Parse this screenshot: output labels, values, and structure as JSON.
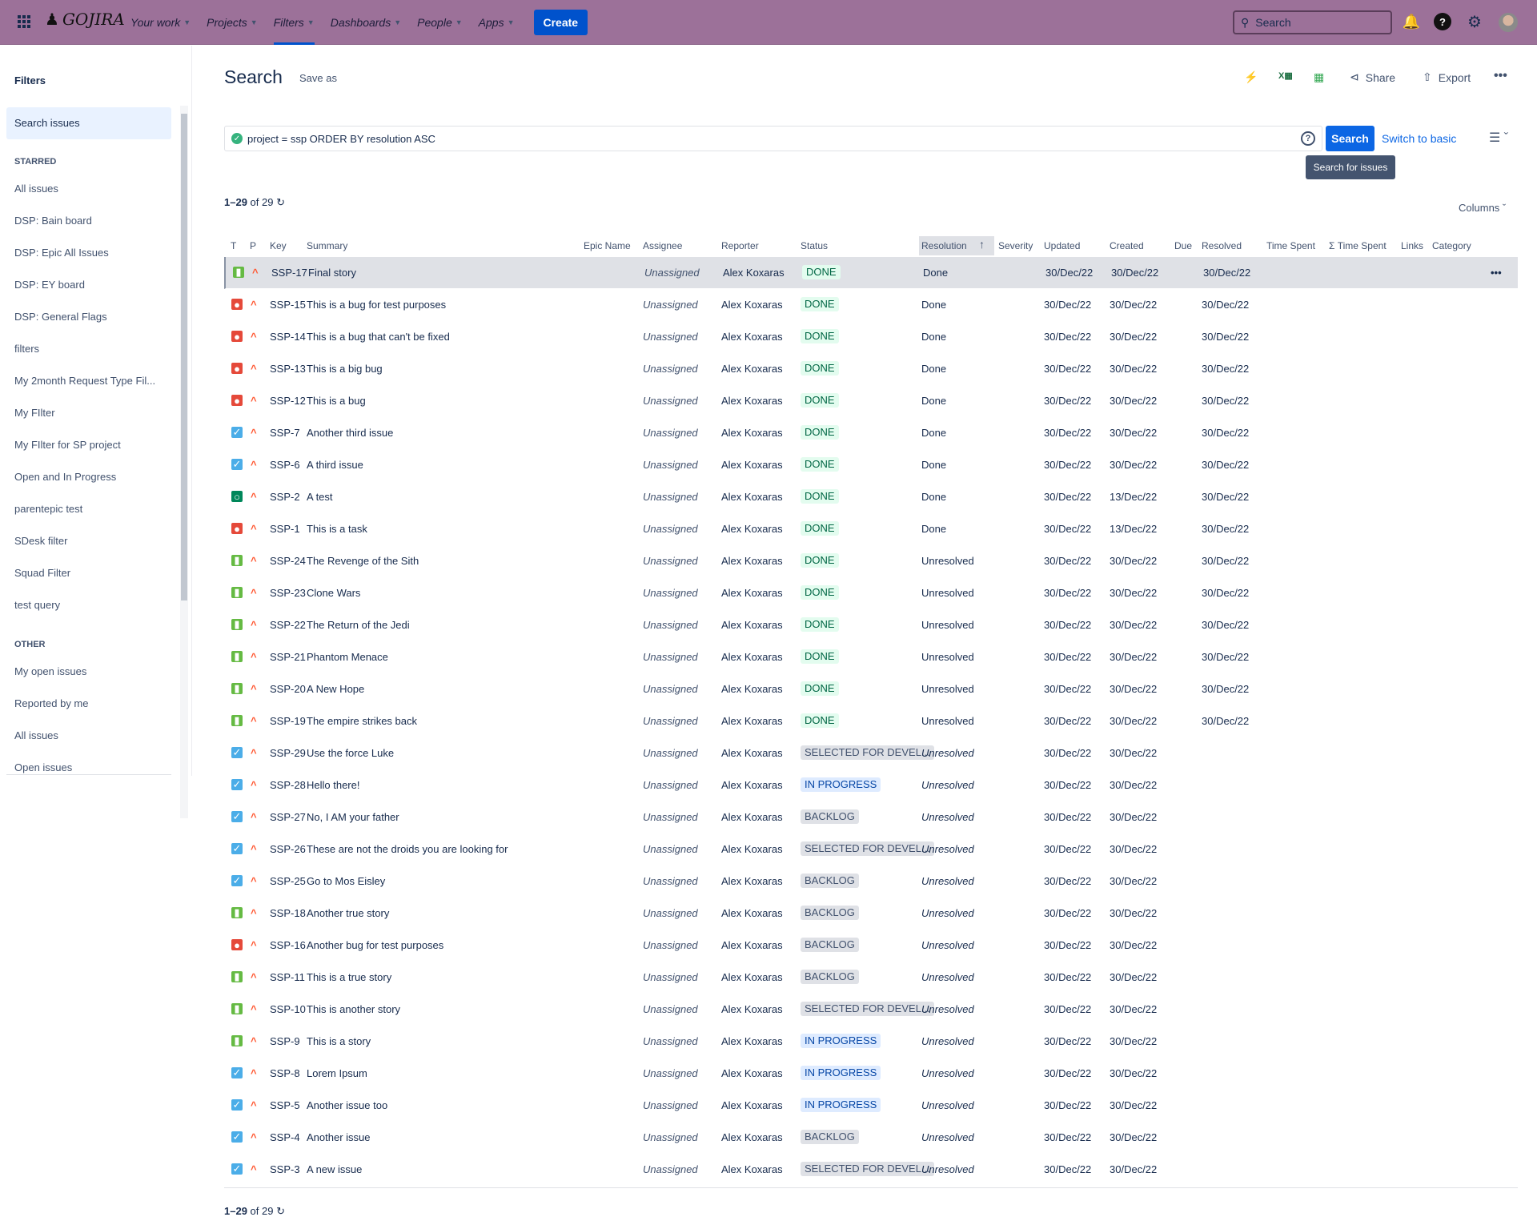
{
  "topnav": {
    "logo": "GOJIRA",
    "items": [
      "Your work",
      "Projects",
      "Filters",
      "Dashboards",
      "People",
      "Apps"
    ],
    "create": "Create",
    "search_placeholder": "Search"
  },
  "sidebar": {
    "title": "Filters",
    "selected": "Search issues",
    "starred_label": "STARRED",
    "starred": [
      "All issues",
      "DSP: Bain board",
      "DSP: Epic All Issues",
      "DSP: EY board",
      "DSP: General Flags",
      "filters",
      "My 2month Request Type Fil...",
      "My FIlter",
      "My FIlter for SP project",
      "Open and In Progress",
      "parentepic test",
      "SDesk filter",
      "Squad Filter",
      "test query"
    ],
    "other_label": "OTHER",
    "other": [
      "My open issues",
      "Reported by me",
      "All issues",
      "Open issues"
    ]
  },
  "page": {
    "title": "Search",
    "save_as": "Save as",
    "share": "Share",
    "export": "Export",
    "jql": "project = ssp ORDER BY resolution ASC",
    "search_button": "Search",
    "switch": "Switch to basic",
    "tooltip": "Search for issues",
    "count_range": "1–29",
    "count_of": "of 29",
    "columns": "Columns"
  },
  "columns": [
    "T",
    "P",
    "Key",
    "Summary",
    "Epic Name",
    "Assignee",
    "Reporter",
    "Status",
    "Resolution",
    "Severity",
    "Updated",
    "Created",
    "Due",
    "Resolved",
    "Time Spent",
    "Σ Time Spent",
    "Links",
    "Category"
  ],
  "colors": {
    "topbar": "#9c7199",
    "primary": "#0c66e4",
    "story": "#65ba43",
    "bug": "#e5493a",
    "task": "#4bade8",
    "other": "#00875a"
  },
  "issues": [
    [
      "story",
      "SSP-17",
      "Final story",
      "Unassigned",
      "Alex Koxaras",
      "DONE",
      "Done",
      "30/Dec/22",
      "30/Dec/22",
      "30/Dec/22"
    ],
    [
      "bug",
      "SSP-15",
      "This is a bug for test purposes",
      "Unassigned",
      "Alex Koxaras",
      "DONE",
      "Done",
      "30/Dec/22",
      "30/Dec/22",
      "30/Dec/22"
    ],
    [
      "bug",
      "SSP-14",
      "This is a bug that can't be fixed",
      "Unassigned",
      "Alex Koxaras",
      "DONE",
      "Done",
      "30/Dec/22",
      "30/Dec/22",
      "30/Dec/22"
    ],
    [
      "bug",
      "SSP-13",
      "This is a big bug",
      "Unassigned",
      "Alex Koxaras",
      "DONE",
      "Done",
      "30/Dec/22",
      "30/Dec/22",
      "30/Dec/22"
    ],
    [
      "bug",
      "SSP-12",
      "This is a bug",
      "Unassigned",
      "Alex Koxaras",
      "DONE",
      "Done",
      "30/Dec/22",
      "30/Dec/22",
      "30/Dec/22"
    ],
    [
      "task",
      "SSP-7",
      "Another third issue",
      "Unassigned",
      "Alex Koxaras",
      "DONE",
      "Done",
      "30/Dec/22",
      "30/Dec/22",
      "30/Dec/22"
    ],
    [
      "task",
      "SSP-6",
      "A third issue",
      "Unassigned",
      "Alex Koxaras",
      "DONE",
      "Done",
      "30/Dec/22",
      "30/Dec/22",
      "30/Dec/22"
    ],
    [
      "other",
      "SSP-2",
      "A test",
      "Unassigned",
      "Alex Koxaras",
      "DONE",
      "Done",
      "30/Dec/22",
      "13/Dec/22",
      "30/Dec/22"
    ],
    [
      "bug",
      "SSP-1",
      "This is a task",
      "Unassigned",
      "Alex Koxaras",
      "DONE",
      "Done",
      "30/Dec/22",
      "13/Dec/22",
      "30/Dec/22"
    ],
    [
      "story",
      "SSP-24",
      "The Revenge of the Sith",
      "Unassigned",
      "Alex Koxaras",
      "DONE",
      "Unresolved",
      "30/Dec/22",
      "30/Dec/22",
      "30/Dec/22"
    ],
    [
      "story",
      "SSP-23",
      "Clone Wars",
      "Unassigned",
      "Alex Koxaras",
      "DONE",
      "Unresolved",
      "30/Dec/22",
      "30/Dec/22",
      "30/Dec/22"
    ],
    [
      "story",
      "SSP-22",
      "The Return of the Jedi",
      "Unassigned",
      "Alex Koxaras",
      "DONE",
      "Unresolved",
      "30/Dec/22",
      "30/Dec/22",
      "30/Dec/22"
    ],
    [
      "story",
      "SSP-21",
      "Phantom Menace",
      "Unassigned",
      "Alex Koxaras",
      "DONE",
      "Unresolved",
      "30/Dec/22",
      "30/Dec/22",
      "30/Dec/22"
    ],
    [
      "story",
      "SSP-20",
      "A New Hope",
      "Unassigned",
      "Alex Koxaras",
      "DONE",
      "Unresolved",
      "30/Dec/22",
      "30/Dec/22",
      "30/Dec/22"
    ],
    [
      "story",
      "SSP-19",
      "The empire strikes back",
      "Unassigned",
      "Alex Koxaras",
      "DONE",
      "Unresolved",
      "30/Dec/22",
      "30/Dec/22",
      "30/Dec/22"
    ],
    [
      "task",
      "SSP-29",
      "Use the force Luke",
      "Unassigned",
      "Alex Koxaras",
      "SELECTED FOR DEVEL...",
      "Unresolved",
      "30/Dec/22",
      "30/Dec/22",
      ""
    ],
    [
      "task",
      "SSP-28",
      "Hello there!",
      "Unassigned",
      "Alex Koxaras",
      "IN PROGRESS",
      "Unresolved",
      "30/Dec/22",
      "30/Dec/22",
      ""
    ],
    [
      "task",
      "SSP-27",
      "No, I AM your father",
      "Unassigned",
      "Alex Koxaras",
      "BACKLOG",
      "Unresolved",
      "30/Dec/22",
      "30/Dec/22",
      ""
    ],
    [
      "task",
      "SSP-26",
      "These are not the droids you are looking for",
      "Unassigned",
      "Alex Koxaras",
      "SELECTED FOR DEVEL...",
      "Unresolved",
      "30/Dec/22",
      "30/Dec/22",
      ""
    ],
    [
      "task",
      "SSP-25",
      "Go to Mos Eisley",
      "Unassigned",
      "Alex Koxaras",
      "BACKLOG",
      "Unresolved",
      "30/Dec/22",
      "30/Dec/22",
      ""
    ],
    [
      "story",
      "SSP-18",
      "Another true story",
      "Unassigned",
      "Alex Koxaras",
      "BACKLOG",
      "Unresolved",
      "30/Dec/22",
      "30/Dec/22",
      ""
    ],
    [
      "bug",
      "SSP-16",
      "Another bug for test purposes",
      "Unassigned",
      "Alex Koxaras",
      "BACKLOG",
      "Unresolved",
      "30/Dec/22",
      "30/Dec/22",
      ""
    ],
    [
      "story",
      "SSP-11",
      "This is a true story",
      "Unassigned",
      "Alex Koxaras",
      "BACKLOG",
      "Unresolved",
      "30/Dec/22",
      "30/Dec/22",
      ""
    ],
    [
      "story",
      "SSP-10",
      "This is another story",
      "Unassigned",
      "Alex Koxaras",
      "SELECTED FOR DEVEL...",
      "Unresolved",
      "30/Dec/22",
      "30/Dec/22",
      ""
    ],
    [
      "story",
      "SSP-9",
      "This is a story",
      "Unassigned",
      "Alex Koxaras",
      "IN PROGRESS",
      "Unresolved",
      "30/Dec/22",
      "30/Dec/22",
      ""
    ],
    [
      "task",
      "SSP-8",
      "Lorem Ipsum",
      "Unassigned",
      "Alex Koxaras",
      "IN PROGRESS",
      "Unresolved",
      "30/Dec/22",
      "30/Dec/22",
      ""
    ],
    [
      "task",
      "SSP-5",
      "Another issue too",
      "Unassigned",
      "Alex Koxaras",
      "IN PROGRESS",
      "Unresolved",
      "30/Dec/22",
      "30/Dec/22",
      ""
    ],
    [
      "task",
      "SSP-4",
      "Another issue",
      "Unassigned",
      "Alex Koxaras",
      "BACKLOG",
      "Unresolved",
      "30/Dec/22",
      "30/Dec/22",
      ""
    ],
    [
      "task",
      "SSP-3",
      "A new issue",
      "Unassigned",
      "Alex Koxaras",
      "SELECTED FOR DEVEL...",
      "Unresolved",
      "30/Dec/22",
      "30/Dec/22",
      ""
    ]
  ]
}
